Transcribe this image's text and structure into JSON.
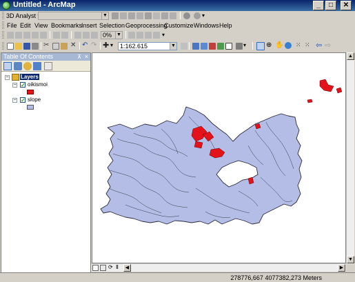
{
  "window": {
    "title": "Untitled - ArcMap"
  },
  "toolbar_3d": {
    "label": "3D Analyst",
    "layer_combo": "",
    "zoom_combo": "0%"
  },
  "menu": [
    "File",
    "Edit",
    "View",
    "Bookmarks",
    "Insert",
    "Selection",
    "Geoprocessing",
    "Customize",
    "Windows",
    "Help"
  ],
  "standard_toolbar": {
    "scale": "1:162.615"
  },
  "toc": {
    "title": "Table Of Contents",
    "root": "Layers",
    "layers": [
      {
        "name": "oikismoi",
        "checked": true,
        "symbol_color": "#e3131b"
      },
      {
        "name": "slope",
        "checked": true,
        "symbol_color": "#b4bde6"
      }
    ]
  },
  "map": {
    "island_fill": "#b4bde6",
    "settlement_fill": "#e3131b"
  },
  "status": {
    "coordinates": "278776,667  4077382,273 Meters"
  }
}
